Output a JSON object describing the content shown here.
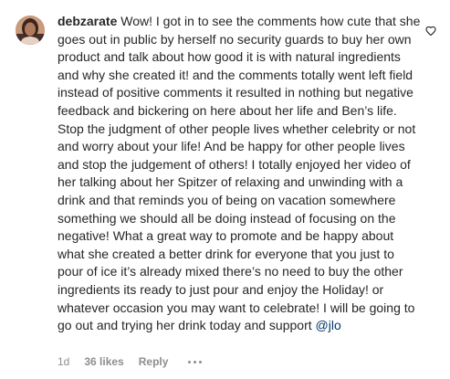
{
  "comment": {
    "username": "debzarate",
    "text": "Wow! I got in to see the comments how cute that she goes out in public by herself no security guards to buy her own product and talk about how good it is with natural ingredients and why she created it! and the comments totally went left field instead of positive comments it resulted in nothing but negative feedback and bickering on here about her life and Ben’s life. Stop the judgment of other people lives whether celebrity or not and worry about your life! And be happy for other people lives and stop the judgement of others! I totally enjoyed her video of her talking about her Spitzer of relaxing and unwinding with a drink and that reminds you of being on vacation somewhere something we should all be doing instead of focusing on the negative! What a great way to promote and be happy about what she created a better drink for everyone that you just to pour of ice it’s already mixed there’s no need to buy the other ingredients its ready to just pour and enjoy the Holiday! or whatever occasion you may want to celebrate! I will be going to go out and trying her drink today and support",
    "mention": "@jlo",
    "age": "1d",
    "likes": "36 likes",
    "reply_label": "Reply"
  },
  "icons": {
    "like": "heart-outline-icon",
    "more": "more-options-icon"
  },
  "colors": {
    "text": "#262626",
    "meta": "#8e8e8e",
    "mention": "#00376b"
  }
}
